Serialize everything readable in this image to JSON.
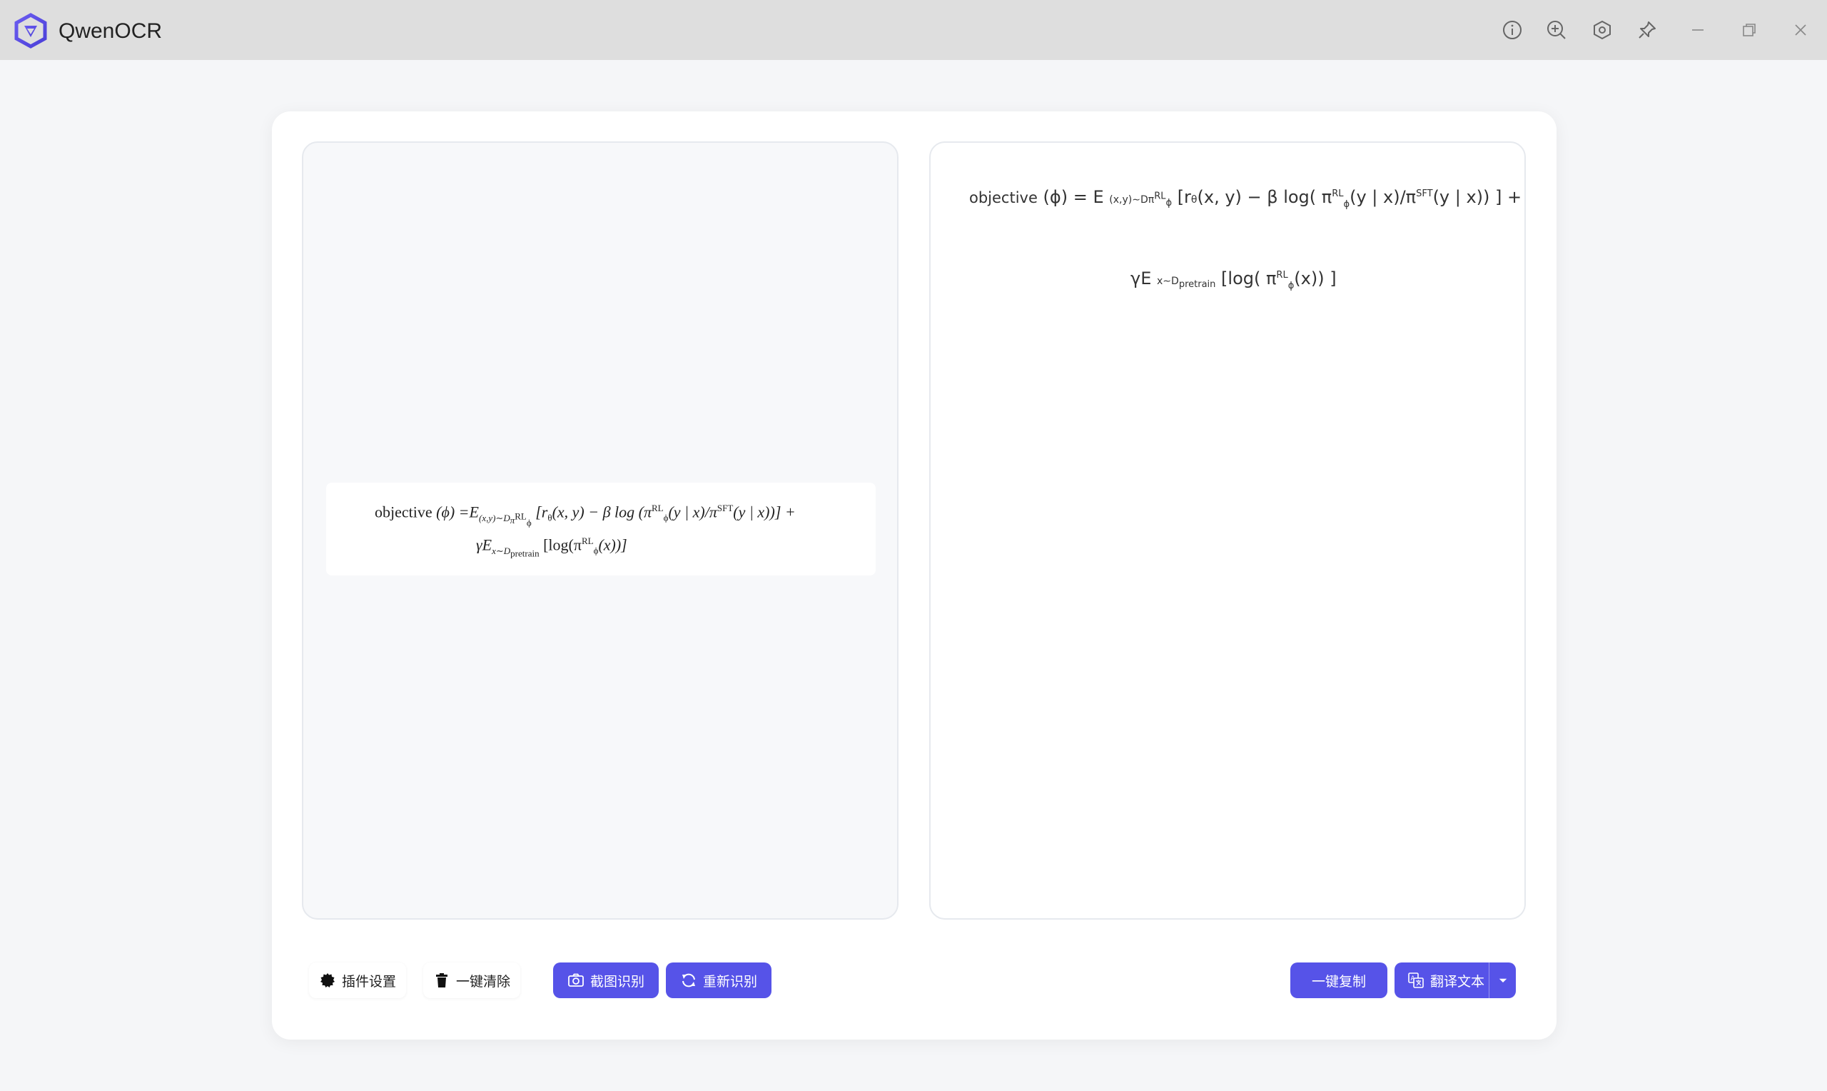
{
  "window": {
    "title": "QwenOCR",
    "controls": [
      "info-icon",
      "zoom-in-icon",
      "settings-hex-icon",
      "pin-icon",
      "minimize-icon",
      "restore-icon",
      "close-icon"
    ]
  },
  "image_preview": {
    "line1": {
      "a": "objective",
      "b": "(ϕ) =",
      "c": "E",
      "c_sub": "(x,y)∼D",
      "c_subsub": "π",
      "c_subsubsup": "RL",
      "c_subsubsub": "ϕ",
      "d": "[r",
      "d_sub": "θ",
      "e": "(x, y) − β log (π",
      "e_sup": "RL",
      "e_sub": "ϕ",
      "f": "(y | x)/π",
      "f_sup": "SFT",
      "g": "(y | x))] +"
    },
    "line2": {
      "a": "γE",
      "a_sub": "x∼D",
      "a_subsub": "pretrain",
      "b": "[log(π",
      "b_sup": "RL",
      "b_sub": "ϕ",
      "c": "(x))]"
    }
  },
  "result": {
    "line1": {
      "a": "objective",
      "b": "(ϕ) = E",
      "b_sub": "(x,y)∼D",
      "b_subsub": "π",
      "b_subsubsup": "RL",
      "b_subsubsub": "ϕ",
      "c": "[r",
      "c_sub": "θ",
      "d": "(x, y) − β log( π",
      "d_sup": "RL",
      "d_sub": "ϕ",
      "e": "(y | x)/π",
      "e_sup": "SFT",
      "f": "(y | x)) ] +"
    },
    "line2": {
      "a": "γE",
      "a_sub": "x∼D",
      "a_subsub": "pretrain",
      "b": "[log( π",
      "b_sup": "RL",
      "b_sub": "ϕ",
      "c": "(x)) ]"
    }
  },
  "toolbar": {
    "plugin_settings": "插件设置",
    "clear_all": "一键清除",
    "screenshot_ocr": "截图识别",
    "re_recognize": "重新识别",
    "copy_all": "一键复制",
    "translate_text": "翻译文本"
  },
  "colors": {
    "accent": "#5653e8",
    "titlebar": "#dedede",
    "background": "#f5f6f8"
  }
}
